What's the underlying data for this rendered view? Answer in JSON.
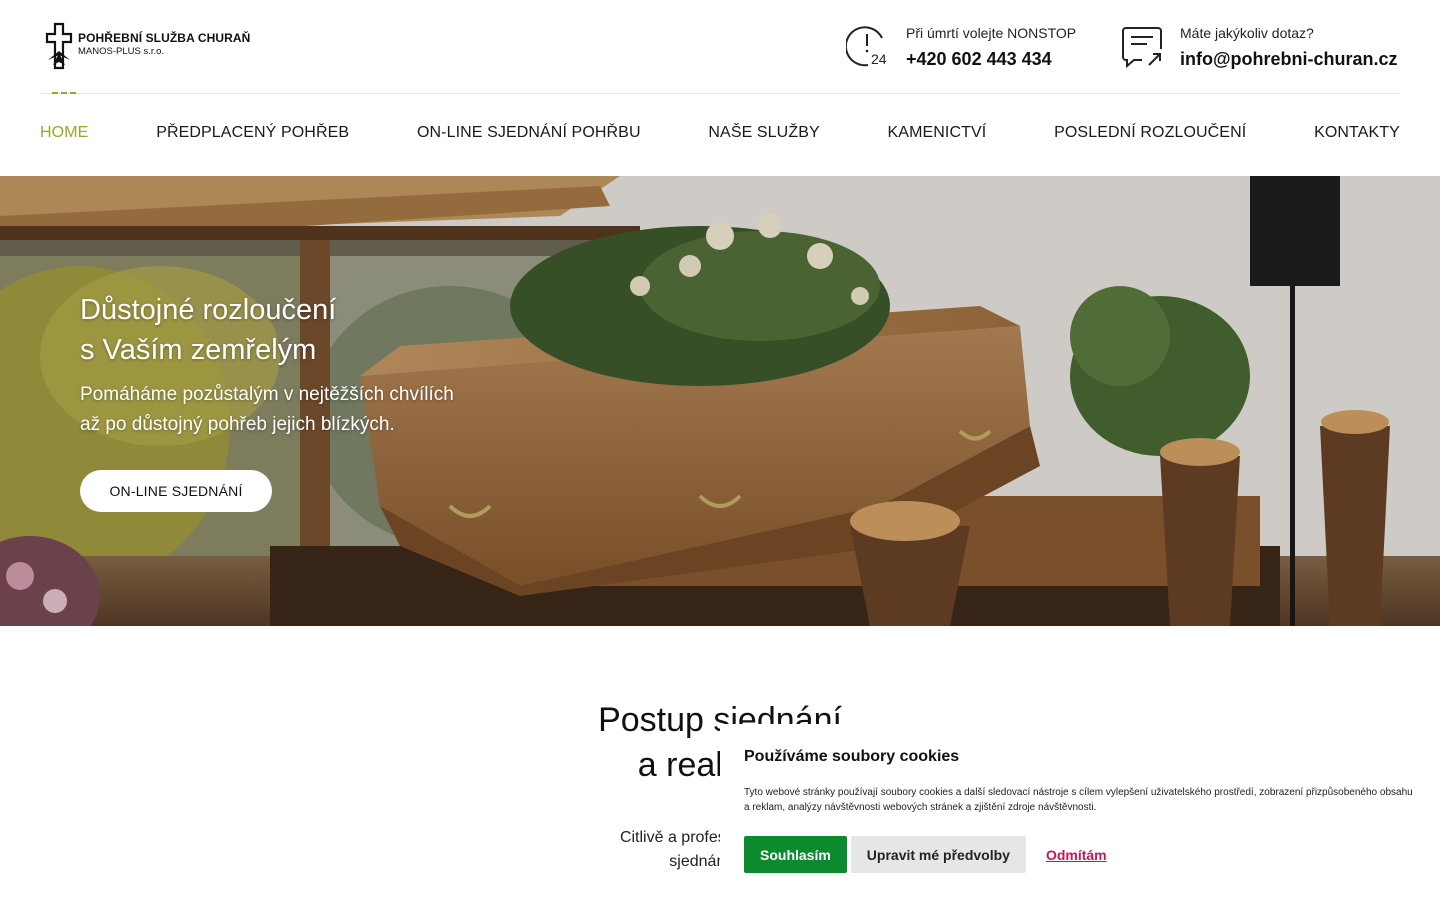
{
  "brand": {
    "name": "POHŘEBNÍ SLUŽBA CHURAŇ",
    "company": "MANOS-PLUS s.r.o."
  },
  "contacts": {
    "phone_label": "Při úmrtí volejte NONSTOP",
    "phone": "+420 602 443 434",
    "mail_label": "Máte jakýkoliv dotaz?",
    "mail": "info@pohrebni-churan.cz"
  },
  "nav": {
    "items": [
      {
        "label": "HOME",
        "active": true
      },
      {
        "label": "PŘEDPLACENÝ POHŘEB",
        "active": false
      },
      {
        "label": "ON-LINE SJEDNÁNÍ POHŘBU",
        "active": false
      },
      {
        "label": "NAŠE SLUŽBY",
        "active": false
      },
      {
        "label": "KAMENICTVÍ",
        "active": false
      },
      {
        "label": "POSLEDNÍ ROZLOUČENÍ",
        "active": false
      },
      {
        "label": "KONTAKTY",
        "active": false
      }
    ]
  },
  "hero": {
    "title_line1": "Důstojné rozloučení",
    "title_line2": "s Vaším zemřelým",
    "sub_line1": "Pomáháme pozůstalým v nejtěžších chvílích",
    "sub_line2": "až po důstojný pohřeb jejich blízkých.",
    "button": "ON-LINE SJEDNÁNÍ"
  },
  "section": {
    "title_line1": "Postup sjednání",
    "title_line2": "a realizace",
    "text_line1": "Citlivě a profesionálně vás p",
    "text_line2": "sjednání a rea"
  },
  "cookie": {
    "title": "Používáme soubory cookies",
    "text": "Tyto webové stránky používají soubory cookies a další sledovací nástroje s cílem vylepšení uživatelského prostředí, zobrazení přizpůsobeného obsahu a reklam, analýzy návštěvnosti webových stránek a zjištění zdroje návštěvnosti.",
    "accept": "Souhlasím",
    "prefs": "Upravit mé předvolby",
    "deny": "Odmítám"
  },
  "colors": {
    "accent": "#9aa62a",
    "accept_button": "#0b8a2e",
    "deny_link": "#c2185b"
  }
}
